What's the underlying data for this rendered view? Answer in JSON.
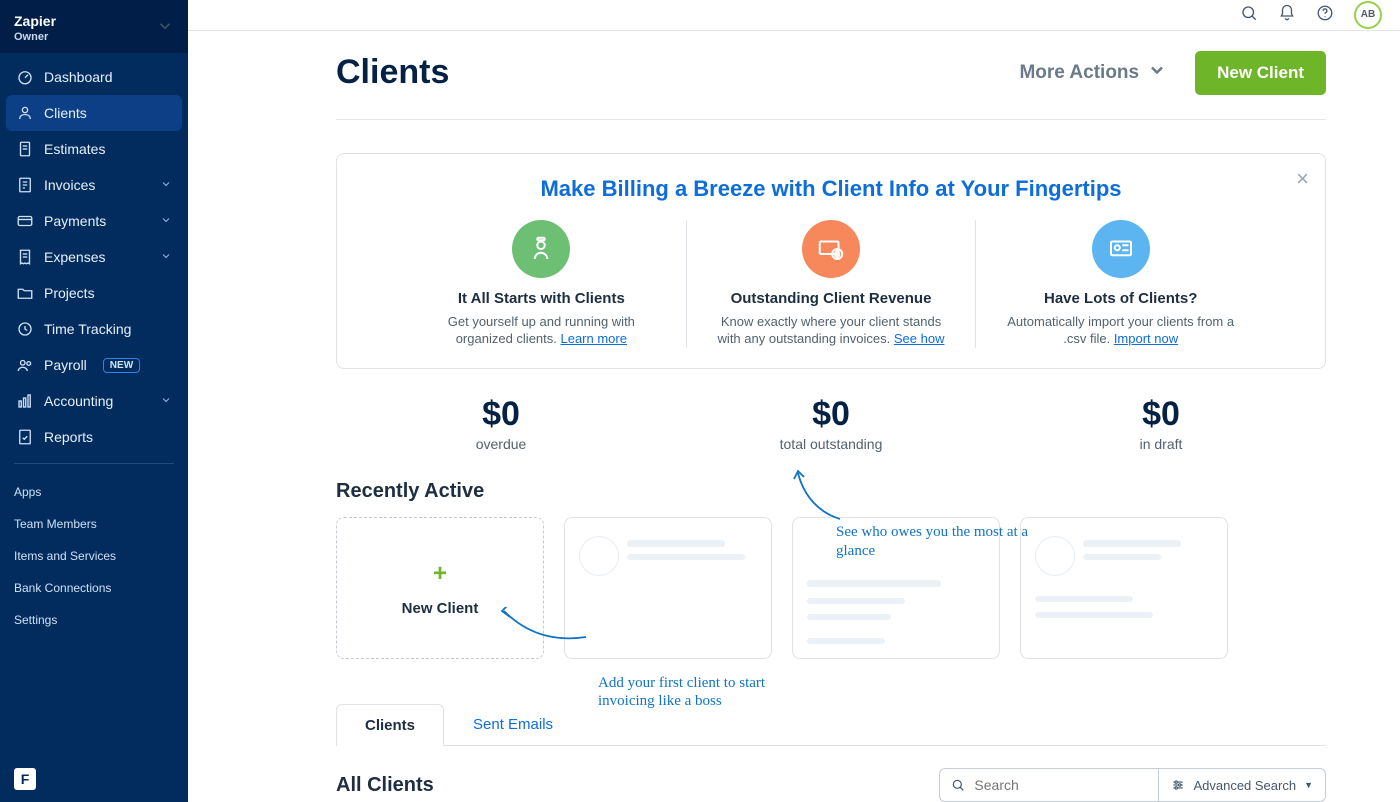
{
  "company": {
    "name": "Zapier",
    "role": "Owner"
  },
  "sidebar": {
    "items": [
      {
        "label": "Dashboard",
        "icon": "gauge"
      },
      {
        "label": "Clients",
        "icon": "person",
        "active": true
      },
      {
        "label": "Estimates",
        "icon": "document"
      },
      {
        "label": "Invoices",
        "icon": "invoice",
        "expandable": true
      },
      {
        "label": "Payments",
        "icon": "card",
        "expandable": true
      },
      {
        "label": "Expenses",
        "icon": "receipt",
        "expandable": true
      },
      {
        "label": "Projects",
        "icon": "folder"
      },
      {
        "label": "Time Tracking",
        "icon": "clock"
      },
      {
        "label": "Payroll",
        "icon": "team",
        "badge": "NEW"
      },
      {
        "label": "Accounting",
        "icon": "chart",
        "expandable": true
      },
      {
        "label": "Reports",
        "icon": "report"
      }
    ],
    "secondary": [
      {
        "label": "Apps"
      },
      {
        "label": "Team Members"
      },
      {
        "label": "Items and Services"
      },
      {
        "label": "Bank Connections"
      },
      {
        "label": "Settings"
      }
    ]
  },
  "topbar": {
    "avatar_initials": "AB"
  },
  "page": {
    "title": "Clients",
    "more_actions_label": "More Actions",
    "new_client_label": "New Client"
  },
  "hero": {
    "title": "Make Billing a Breeze with Client Info at Your Fingertips",
    "cols": [
      {
        "title": "It All Starts with Clients",
        "body": "Get yourself up and running with organized clients.",
        "link": "Learn more"
      },
      {
        "title": "Outstanding Client Revenue",
        "body": "Know exactly where your client stands with any outstanding invoices.",
        "link": "See how"
      },
      {
        "title": "Have Lots of Clients?",
        "body": "Automatically import your clients from a .csv file.",
        "link": "Import now"
      }
    ]
  },
  "stats": [
    {
      "value": "$0",
      "label": "overdue"
    },
    {
      "value": "$0",
      "label": "total outstanding"
    },
    {
      "value": "$0",
      "label": "in draft"
    }
  ],
  "recently_active": {
    "title": "Recently Active",
    "new_card_label": "New Client",
    "callout_right": "See who owes you the most at a glance",
    "callout_left": "Add your first client to start invoicing like a boss"
  },
  "tabs": [
    {
      "label": "Clients",
      "active": true
    },
    {
      "label": "Sent Emails"
    }
  ],
  "list": {
    "title": "All Clients",
    "search_placeholder": "Search",
    "advanced_search_label": "Advanced Search"
  }
}
